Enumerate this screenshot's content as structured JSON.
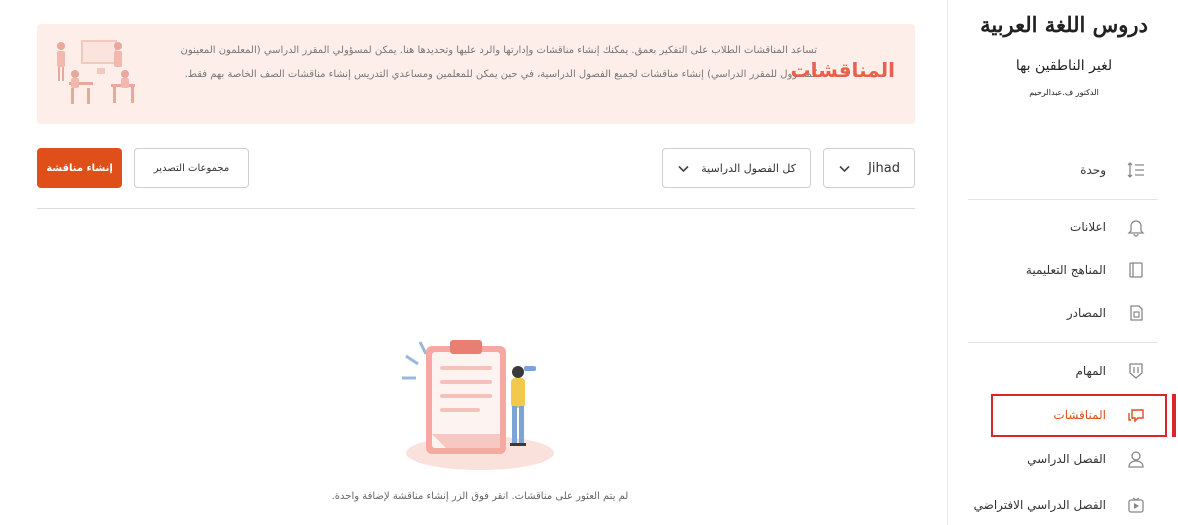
{
  "banner": {
    "title": "المناقشات",
    "description": "تساعد المناقشات الطلاب على التفكير بعمق. يمكنك إنشاء مناقشات وإدارتها والرد عليها وتحديدها هنا. يمكن لمسؤولي المقرر الدراسي (المعلمون المعينون كمسؤول للمقرر الدراسي) إنشاء مناقشات لجميع الفصول الدراسية، في حين يمكن للمعلمين ومساعدي التدريس إنشاء مناقشات الصف الخاصة بهم فقط."
  },
  "toolbar": {
    "create_label": "إنشاء مناقشة",
    "export_label": "مجموعات التصدير",
    "class_filter_value": "كل الفصول الدراسية",
    "teacher_filter_value": "Jihad"
  },
  "empty_state": {
    "message": "لم يتم العثور على مناقشات. انقر فوق الزر إنشاء مناقشة لإضافة واحدة."
  },
  "sidebar": {
    "logo": {
      "title": "دروس اللغة العربية",
      "subtitle": "لغير الناطقين بها",
      "author": "الدكتور ف.عبدالرحيم"
    },
    "items": [
      {
        "label": "وحدة",
        "icon": "outline-list-icon"
      },
      {
        "label": "اعلانات",
        "icon": "bell-icon"
      },
      {
        "label": "المناهج التعليمية",
        "icon": "book-icon"
      },
      {
        "label": "المصادر",
        "icon": "resources-icon"
      },
      {
        "label": "المهام",
        "icon": "shield-badge-icon"
      },
      {
        "label": "المناقشات",
        "icon": "chat-bubbles-icon",
        "active": true
      },
      {
        "label": "الفصل الدراسي",
        "icon": "person-icon"
      },
      {
        "label": "الفصل الدراسي الافتراضي",
        "icon": "video-play-icon"
      }
    ]
  },
  "colors": {
    "accent": "#e04f1a",
    "banner_bg": "#fdeeea",
    "banner_title": "#e8614d",
    "highlight": "#d9262c"
  }
}
